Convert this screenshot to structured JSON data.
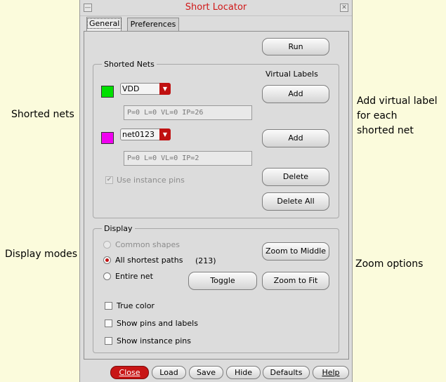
{
  "annotations": {
    "shorted_nets": "Shorted nets",
    "display_modes": "Display modes",
    "virtual_label": [
      "Add virtual label",
      "for each",
      "shorted net"
    ],
    "zoom_options": "Zoom options"
  },
  "window": {
    "title": "Short Locator"
  },
  "tabs": [
    {
      "label": "General",
      "active": true
    },
    {
      "label": "Preferences",
      "active": false
    }
  ],
  "general": {
    "run_label": "Run",
    "shorted_nets": {
      "legend": "Shorted Nets",
      "virtual_labels_heading": "Virtual Labels",
      "nets": [
        {
          "name": "VDD",
          "color": "#00E000",
          "info": "P=0 L=0 VL=0 IP=26",
          "add_label": "Add"
        },
        {
          "name": "net0123",
          "color": "#F000F0",
          "info": "P=0 L=0 VL=0 IP=2",
          "add_label": "Add"
        }
      ],
      "use_instance_pins": {
        "label": "Use instance pins",
        "checked": true,
        "enabled": false
      },
      "delete_label": "Delete",
      "delete_all_label": "Delete All"
    },
    "display": {
      "legend": "Display",
      "modes": [
        {
          "label": "Common shapes",
          "selected": false,
          "enabled": false
        },
        {
          "label": "All shortest paths",
          "selected": true,
          "enabled": true
        },
        {
          "label": "Entire net",
          "selected": false,
          "enabled": true
        }
      ],
      "path_count": "(213)",
      "zoom_to_middle_label": "Zoom to Middle",
      "toggle_label": "Toggle",
      "zoom_to_fit_label": "Zoom to Fit",
      "options": [
        {
          "label": "True color",
          "checked": false
        },
        {
          "label": "Show pins and labels",
          "checked": false
        },
        {
          "label": "Show instance pins",
          "checked": false
        }
      ]
    }
  },
  "footer": {
    "close_label": "Close",
    "load_label": "Load",
    "save_label": "Save",
    "hide_label": "Hide",
    "defaults_label": "Defaults",
    "help_label": "Help"
  },
  "colors": {
    "accent": "#C81515",
    "title_text": "#D01818",
    "page_background": "#FBFBDC",
    "dialog_background": "#DCDCDC"
  }
}
